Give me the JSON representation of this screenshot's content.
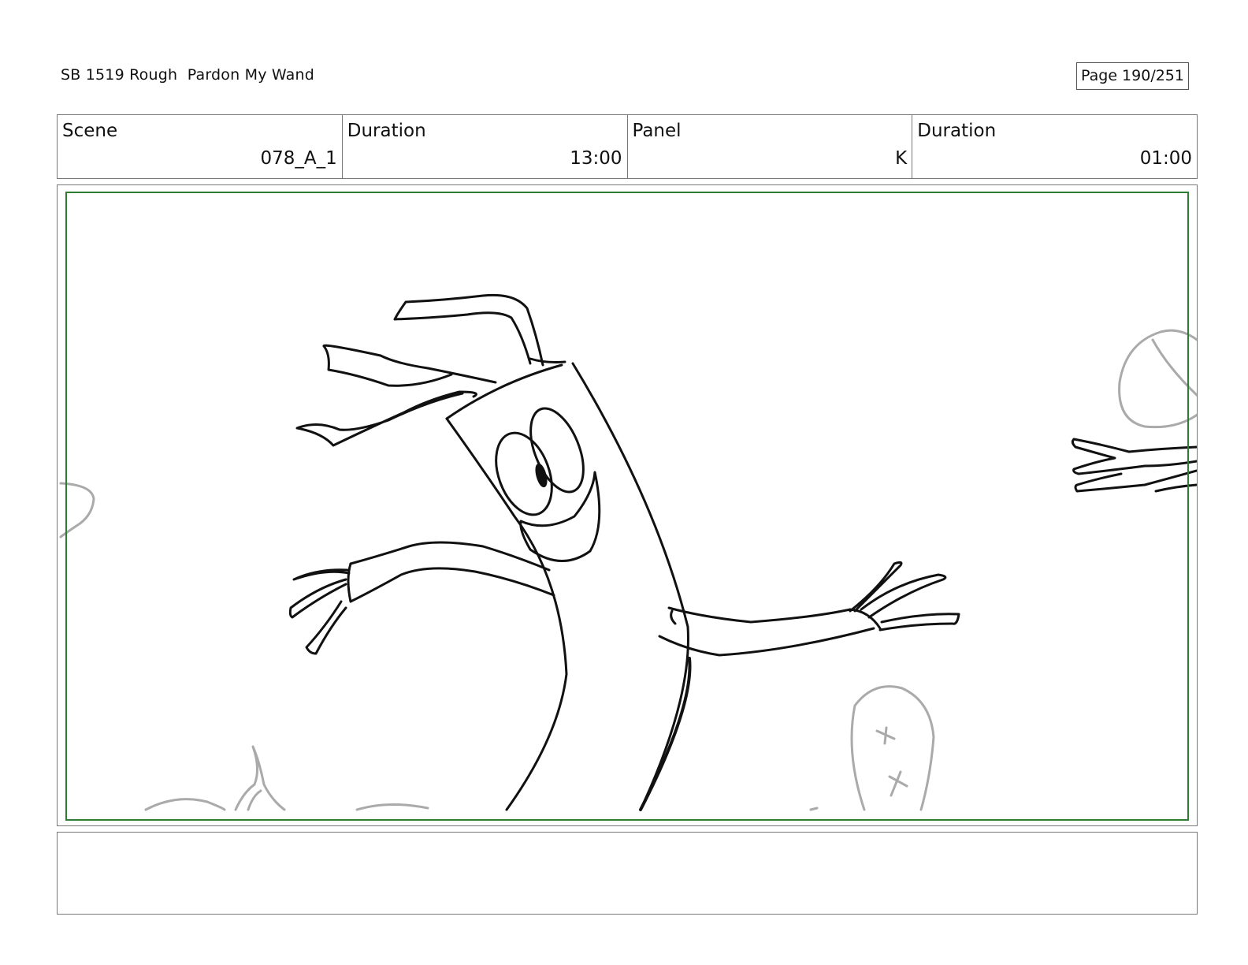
{
  "header": {
    "title": "SB 1519 Rough  Pardon My Wand",
    "page": "Page 190/251"
  },
  "info": [
    {
      "label": "Scene",
      "value": "078_A_1"
    },
    {
      "label": "Duration",
      "value": "13:00"
    },
    {
      "label": "Panel",
      "value": "K"
    },
    {
      "label": "Duration",
      "value": "01:00"
    }
  ],
  "panel": {
    "safe_frame_color": "#2e7d32",
    "drawing": "rough sketch of a smiling tube character with arms outstretched"
  },
  "notes": {
    "text": ""
  }
}
